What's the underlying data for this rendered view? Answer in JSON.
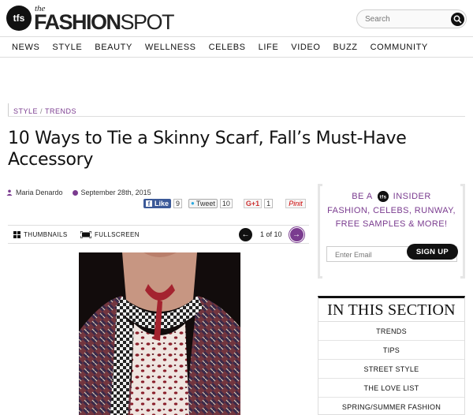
{
  "brand": {
    "the": "the",
    "name_bold": "FASHION",
    "name_thin": "SPOT",
    "mark_text": "tfs"
  },
  "search": {
    "placeholder": "Search"
  },
  "nav": [
    "NEWS",
    "STYLE",
    "BEAUTY",
    "WELLNESS",
    "CELEBS",
    "LIFE",
    "VIDEO",
    "BUZZ",
    "COMMUNITY"
  ],
  "breadcrumb": {
    "first": "STYLE",
    "sep": "/",
    "second": "TRENDS"
  },
  "article": {
    "title": "10 Ways to Tie a Skinny Scarf, Fall’s Must-Have Accessory",
    "author": "Maria Denardo",
    "date": "September 28th, 2015"
  },
  "share": {
    "fb_label": "Like",
    "fb_count": "9",
    "tw_label": "Tweet",
    "tw_count": "10",
    "gp_label": "G+1",
    "gp_count": "1",
    "pin_label": "Pinit"
  },
  "gallery": {
    "thumbnails": "THUMBNAILS",
    "fullscreen": "FULLSCREEN",
    "pager": "1 of 10"
  },
  "insider": {
    "line1_a": "BE A",
    "line1_b": "INSIDER",
    "line2": "FASHION, CELEBS, RUNWAY,",
    "line3": "FREE SAMPLES & MORE!",
    "email_placeholder": "Enter Email",
    "signup": "SIGN UP"
  },
  "section": {
    "title": "IN THIS SECTION",
    "items": [
      "TRENDS",
      "TIPS",
      "STREET STYLE",
      "THE LOVE LIST",
      "SPRING/SUMMER FASHION"
    ]
  },
  "colors": {
    "accent": "#7a3b8f",
    "dark": "#111111"
  }
}
